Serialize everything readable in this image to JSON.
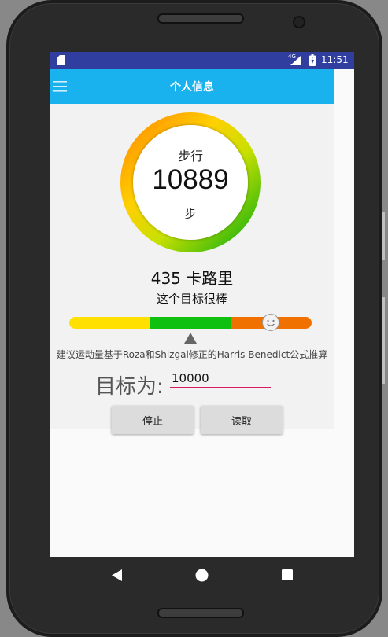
{
  "status": {
    "network": "4G",
    "time": "11:51"
  },
  "header": {
    "title": "个人信息"
  },
  "steps": {
    "label": "步行",
    "count": "10889",
    "unit": "步"
  },
  "calories": "435 卡路里",
  "rating": {
    "text": "这个目标很棒",
    "level_fraction": 0.83
  },
  "note": "建议运动量基于Roza和Shizgal修正的Harris-Benedict公式推算",
  "goal": {
    "label": "目标为:",
    "value": "10000"
  },
  "buttons": {
    "stop": "停止",
    "read": "读取"
  },
  "icons": {
    "menu": "menu-icon",
    "sim": "sim-card-icon",
    "battery": "battery-charging-icon",
    "pointer": "triangle-up-icon",
    "smiley": "smiley-face-icon"
  },
  "colors": {
    "status_bar": "#303f9f",
    "app_bar": "#1ab2ee",
    "yellow": "#ffe000",
    "green": "#10c010",
    "orange": "#f07000",
    "input_underline": "#d81b60"
  }
}
